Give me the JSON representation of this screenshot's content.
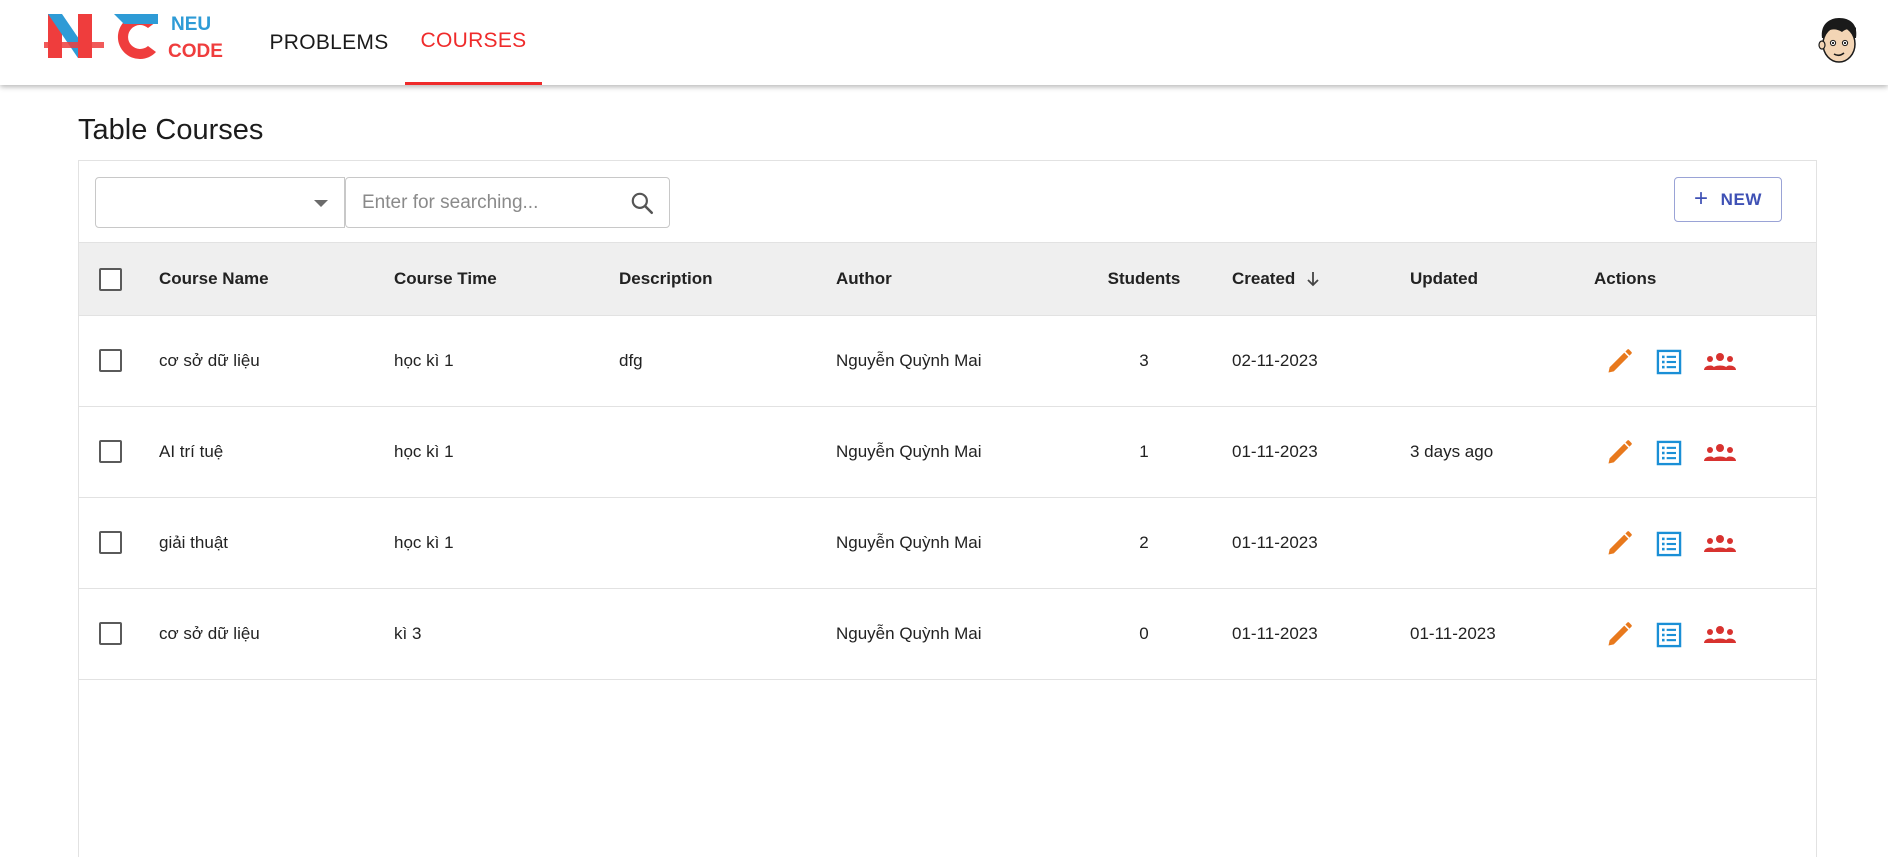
{
  "brand": {
    "logo_text_top": "NEU",
    "logo_text_bottom": "CODE",
    "colors": {
      "red": "#ef3d3d",
      "blue": "#2e9bd6"
    }
  },
  "nav": {
    "items": [
      {
        "label": "PROBLEMS",
        "active": false
      },
      {
        "label": "COURSES",
        "active": true
      }
    ],
    "accent": "#ef2b2b"
  },
  "page": {
    "title": "Table Courses"
  },
  "toolbar": {
    "select_value": "",
    "search_placeholder": "Enter for searching...",
    "search_value": "",
    "new_label": "NEW"
  },
  "table": {
    "columns": {
      "name": "Course Name",
      "time": "Course Time",
      "description": "Description",
      "author": "Author",
      "students": "Students",
      "created": "Created",
      "updated": "Updated",
      "actions": "Actions"
    },
    "sort": {
      "column": "Created",
      "direction": "desc"
    },
    "rows": [
      {
        "name": "cơ sở dữ liệu",
        "time": "học kì 1",
        "description": "dfg",
        "author": "Nguyễn Quỳnh Mai",
        "students": "3",
        "created": "02-11-2023",
        "updated": ""
      },
      {
        "name": "AI trí tuệ",
        "time": "học kì 1",
        "description": "",
        "author": "Nguyễn Quỳnh Mai",
        "students": "1",
        "created": "01-11-2023",
        "updated": "3 days ago"
      },
      {
        "name": "giải thuật",
        "time": "học kì 1",
        "description": "",
        "author": "Nguyễn Quỳnh Mai",
        "students": "2",
        "created": "01-11-2023",
        "updated": ""
      },
      {
        "name": "cơ sở dữ liệu",
        "time": "kì 3",
        "description": "",
        "author": "Nguyễn Quỳnh Mai",
        "students": "0",
        "created": "01-11-2023",
        "updated": "01-11-2023"
      }
    ],
    "action_icons": [
      {
        "icon": "pencil-icon",
        "color": "#e8791d"
      },
      {
        "icon": "list-icon",
        "color": "#1a8fd6"
      },
      {
        "icon": "group-icon",
        "color": "#d8322f"
      }
    ]
  }
}
